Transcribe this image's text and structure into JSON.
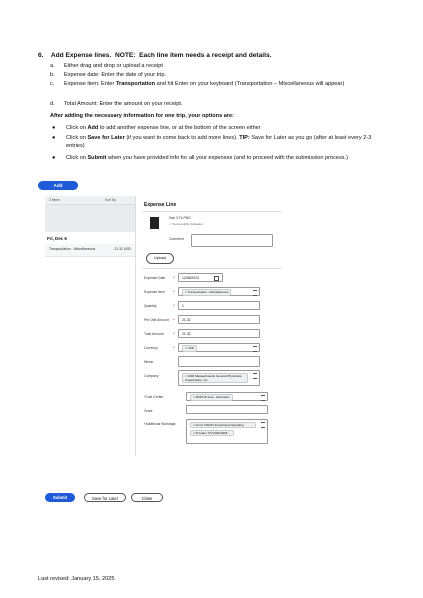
{
  "instructions": {
    "step_number": "6.",
    "step_title": "Add Expense lines.",
    "step_note_label": "NOTE:",
    "step_note": "Each line item needs a receipt and details.",
    "items": [
      {
        "letter": "a.",
        "text": "Either drag and drop or upload a receipt"
      },
      {
        "letter": "b.",
        "text": "Expense date:  Enter the date of your trip."
      },
      {
        "letter": "c.",
        "pre": "Expense item:  Enter ",
        "bold": "Transportation",
        "post": " and hit Enter on your keyboard (Transportation – Miscellaneous will appear)"
      },
      {
        "letter": "d.",
        "text": "Total Amount:  Enter the amount on your receipt."
      }
    ],
    "after_text": "After adding the necessary information for one trip, your options are:",
    "bullets": [
      {
        "pre": "Click on ",
        "bold": "Add",
        "post": " to add another expense line, or at the bottom of the screen either"
      },
      {
        "pre": "Click on ",
        "bold": "Save for Later",
        "post": " (if you want to come back to add more lines).  ",
        "bold2": "TIP:",
        "post2": " Save for Later as you go (after at least every 2-3 entries)"
      },
      {
        "pre": "Click on ",
        "bold": "Submit",
        "post": " when you have provided info for all your expenses (and to proceed with the submission process.)"
      }
    ]
  },
  "screenshot": {
    "add_button": "Add",
    "left_header": {
      "col1": "2 items",
      "col2": "Sort By"
    },
    "date_group": "Fri, Dec 6",
    "line_item": {
      "title": "Transportation - Miscellaneous",
      "amount": "21.32 USD"
    },
    "expense_line_title": "Expense Line",
    "receipt": {
      "name": "Sae 3 Tk.PNG",
      "status": "Successfully Uploaded"
    },
    "comment_label": "Comment",
    "upload_button": "Upload",
    "fields": {
      "expense_date": {
        "label": "Expense Date",
        "value": "12/06/2024"
      },
      "expense_item": {
        "label": "Expense Item",
        "value": "Transportation - Miscellaneous"
      },
      "quantity": {
        "label": "Quantity",
        "value": "1"
      },
      "per_unit": {
        "label": "Per Unit Amount",
        "value": "21.32"
      },
      "total": {
        "label": "Total Amount",
        "value": "21.32"
      },
      "currency": {
        "label": "Currency",
        "value": "USD"
      },
      "memo": {
        "label": "Memo",
        "value": ""
      },
      "company": {
        "label": "Company",
        "value": "1000 Massachusetts General Physicians Organization, Inc."
      },
      "cost_center": {
        "label": "*Cost Center",
        "value": "MGPOP Area - Education"
      },
      "grant": {
        "label": "Grant",
        "value": ""
      },
      "worktags": {
        "label": "*Additional Worktags",
        "value1": "Fund: F0015 Unrestricted Operating",
        "value2": "Provider: PV100012905"
      }
    },
    "bottom_buttons": {
      "submit": "Submit",
      "save": "Save for Later",
      "close": "Close"
    }
  },
  "footer": "Last revised:  January 15, 2025",
  "colors": {
    "primary_button": "#1f5bd8",
    "required": "#cc0000"
  }
}
